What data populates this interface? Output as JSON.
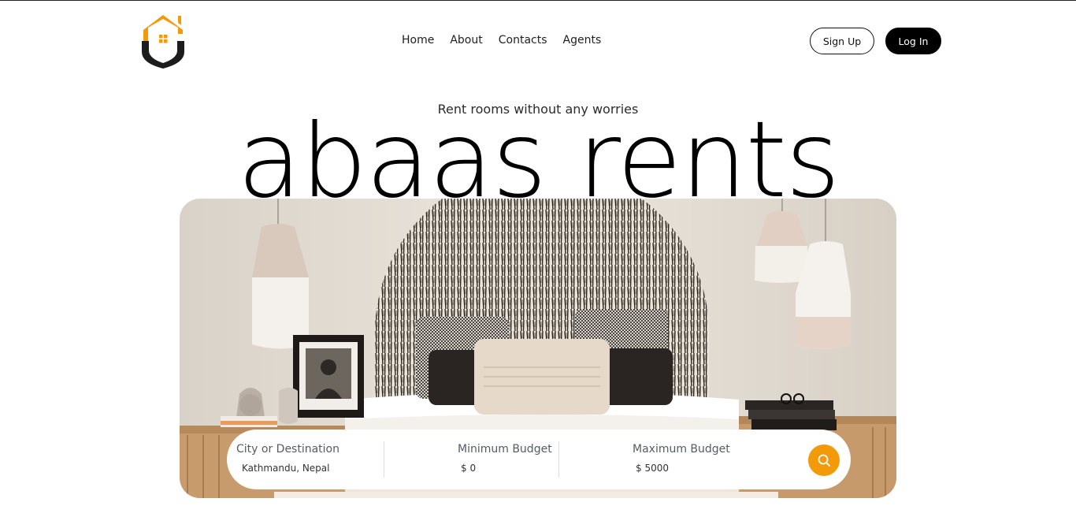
{
  "nav": {
    "logo_icon": "house-shield-logo-icon",
    "links": [
      {
        "label": "Home"
      },
      {
        "label": "About"
      },
      {
        "label": "Contacts"
      },
      {
        "label": "Agents"
      }
    ],
    "signup_label": "Sign Up",
    "login_label": "Log In"
  },
  "hero": {
    "tagline": "Rent rooms without any worries",
    "brand": "abaas rents",
    "image": "bedroom-interior-photo"
  },
  "search": {
    "city": {
      "label": "City or Destination",
      "value": "Kathmandu, Nepal"
    },
    "min_budget": {
      "label": "Minimum Budget",
      "value": "$ 0"
    },
    "max_budget": {
      "label": "Maximum Budget",
      "value": "$ 5000"
    },
    "button_icon": "search-icon"
  },
  "colors": {
    "accent": "#f29a0a",
    "dark": "#000000",
    "text": "#1f1f1f"
  }
}
